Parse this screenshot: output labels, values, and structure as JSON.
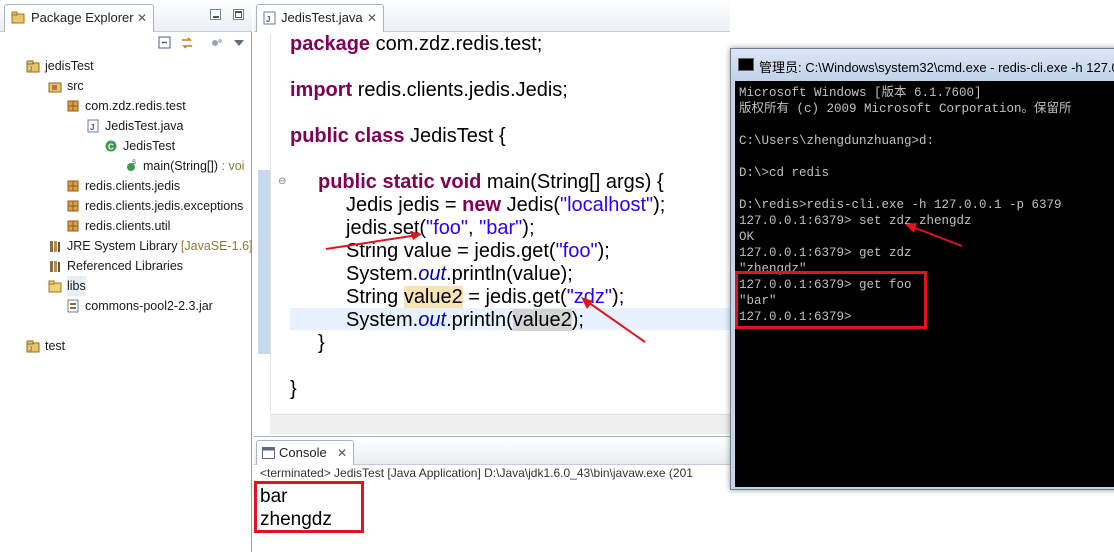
{
  "package_explorer": {
    "tab_title": "Package Explorer",
    "tree": [
      {
        "label": "jedisTest",
        "decoration": "",
        "icon": "project-icon"
      },
      {
        "label": "src",
        "decoration": "",
        "icon": "source-folder-icon"
      },
      {
        "label": "com.zdz.redis.test",
        "decoration": "",
        "icon": "package-icon"
      },
      {
        "label": "JedisTest.java",
        "decoration": "",
        "icon": "java-file-icon"
      },
      {
        "label": "JedisTest",
        "decoration": "",
        "icon": "class-icon"
      },
      {
        "label": "main(String[])",
        "decoration": " : voi",
        "icon": "method-icon"
      },
      {
        "label": "redis.clients.jedis",
        "decoration": "",
        "icon": "package-icon"
      },
      {
        "label": "redis.clients.jedis.exceptions",
        "decoration": "",
        "icon": "package-icon"
      },
      {
        "label": "redis.clients.util",
        "decoration": "",
        "icon": "package-icon"
      },
      {
        "label": "JRE System Library",
        "decoration": " [JavaSE-1.6]",
        "icon": "library-icon"
      },
      {
        "label": "Referenced Libraries",
        "decoration": "",
        "icon": "library-icon"
      },
      {
        "label": "libs",
        "decoration": "",
        "icon": "folder-icon"
      },
      {
        "label": "commons-pool2-2.3.jar",
        "decoration": "",
        "icon": "jar-icon"
      },
      {
        "label": "test",
        "decoration": "",
        "icon": "project-icon"
      }
    ]
  },
  "editor": {
    "tab_title": "JedisTest.java",
    "code": {
      "l1_kw": "package",
      "l1_rest": " com.zdz.redis.test;",
      "l2_kw": "import",
      "l2_rest": " redis.clients.jedis.Jedis;",
      "l3_kw": "public class",
      "l3_rest": " JedisTest {",
      "l4_kw": "public static void",
      "l4_rest": " main(String[] args) {",
      "l5_a": "Jedis jedis = ",
      "l5_kw": "new",
      "l5_b": " Jedis(",
      "l5_str": "\"localhost\"",
      "l5_c": ");",
      "l6_a": "jedis.set(",
      "l6_s1": "\"foo\"",
      "l6_b": ", ",
      "l6_s2": "\"bar\"",
      "l6_c": ");",
      "l7_a": "String value = jedis.get(",
      "l7_s": "\"foo\"",
      "l7_c": ");",
      "l8_a": "System.",
      "l8_it": "out",
      "l8_c": ".println(value);",
      "l9_a": "String ",
      "l9_occ": "value2",
      "l9_b": " = jedis.get(",
      "l9_s": "\"zdz\"",
      "l9_c": ");",
      "l10_a": "System.",
      "l10_it": "out",
      "l10_b": ".println(",
      "l10_occ": "value2",
      "l10_c": ");",
      "l11": "}",
      "l12": "}"
    }
  },
  "console": {
    "tab_title": "Console",
    "status": "<terminated> JedisTest [Java Application] D:\\Java\\jdk1.6.0_43\\bin\\javaw.exe (201",
    "output": "bar\nzhengdz"
  },
  "cmd": {
    "title": "管理员: C:\\Windows\\system32\\cmd.exe - redis-cli.exe  -h 127.0",
    "lines": "Microsoft Windows [版本 6.1.7600]\n版权所有 (c) 2009 Microsoft Corporation。保留所\n\nC:\\Users\\zhengdunzhuang>d:\n\nD:\\>cd redis\n\nD:\\redis>redis-cli.exe -h 127.0.0.1 -p 6379\n127.0.0.1:6379> set zdz zhengdz\nOK\n127.0.0.1:6379> get zdz\n\"zhengdz\"\n127.0.0.1:6379> get foo\n\"bar\"\n127.0.0.1:6379>"
  },
  "colors": {
    "annotation_red": "#e0141e",
    "keyword": "#7f0055",
    "string": "#2a00ff",
    "static_field": "#0000c0"
  }
}
